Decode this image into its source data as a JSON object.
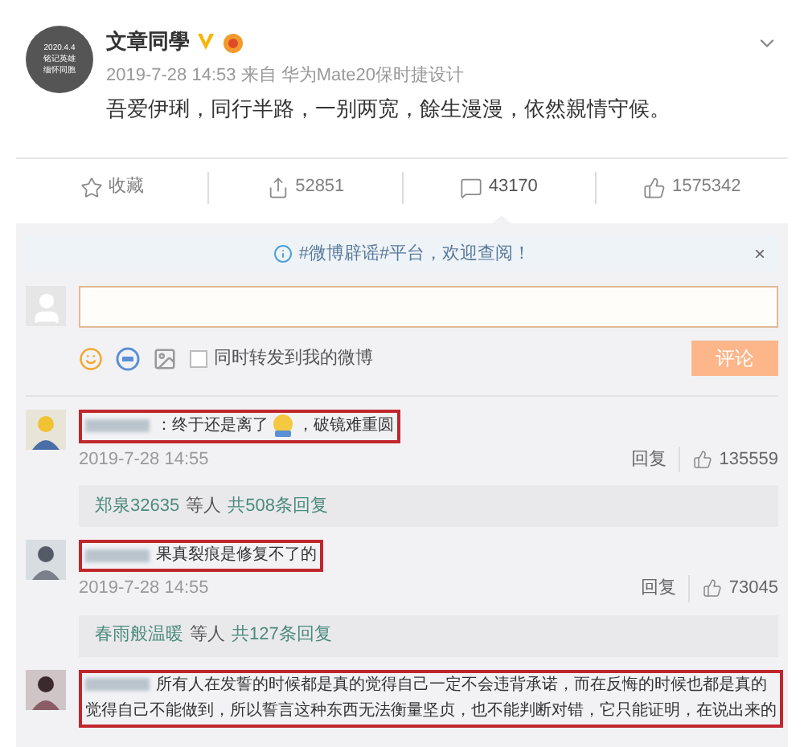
{
  "post": {
    "avatar_lines": [
      "2020.4.4",
      "铭记英雄",
      "缅怀同胞"
    ],
    "author": "文章同學",
    "verified": true,
    "meta": "2019-7-28 14:53 来自 华为Mate20保时捷设计",
    "text": "吾爱伊琍，同行半路，一别两宽，餘生漫漫，依然親情守候。"
  },
  "actions": [
    {
      "kind": "favorite",
      "label": "收藏",
      "selected": false
    },
    {
      "kind": "share",
      "label": "52851",
      "selected": false
    },
    {
      "kind": "comment",
      "label": "43170",
      "selected": true
    },
    {
      "kind": "like",
      "label": "1575342",
      "selected": false
    }
  ],
  "notice": {
    "text": "#微博辟谣#平台，欢迎查阅！",
    "close": "×"
  },
  "composer": {
    "repost_label": "同时转发到我的微博",
    "repost_checked": false,
    "submit": "评论",
    "submit_disabled": true
  },
  "comments": [
    {
      "avatar": {
        "kind": "picture"
      },
      "highlighted": true,
      "segments": [
        {
          "kind": "text",
          "text": "：终于还是离了"
        },
        {
          "kind": "emoji"
        },
        {
          "kind": "text",
          "text": "，破镜难重圆"
        }
      ],
      "time": "2019-7-28 14:55",
      "reply": "回复",
      "likes": "135559",
      "replies": {
        "users": "郑泉32635",
        "middle": "等人",
        "total": "共508条回复"
      }
    },
    {
      "avatar": {
        "kind": "picture"
      },
      "highlighted": true,
      "segments": [
        {
          "kind": "text",
          "text": "果真裂痕是修复不了的"
        }
      ],
      "time": "2019-7-28 14:55",
      "reply": "回复",
      "likes": "73045",
      "replies": {
        "users": "春雨般温暖",
        "middle": "等人",
        "total": "共127条回复"
      }
    },
    {
      "avatar": {
        "kind": "picture"
      },
      "highlighted": true,
      "segments": [
        {
          "kind": "text",
          "text": "所有人在发誓的时候都是真的觉得自己一定不会违背承诺，而在反悔的时候也都是真的"
        },
        {
          "kind": "line",
          "text": "觉得自己不能做到，所以誓言这种东西无法衡量坚贞，也不能判断对错，它只能证明，在说出来的"
        }
      ]
    }
  ]
}
